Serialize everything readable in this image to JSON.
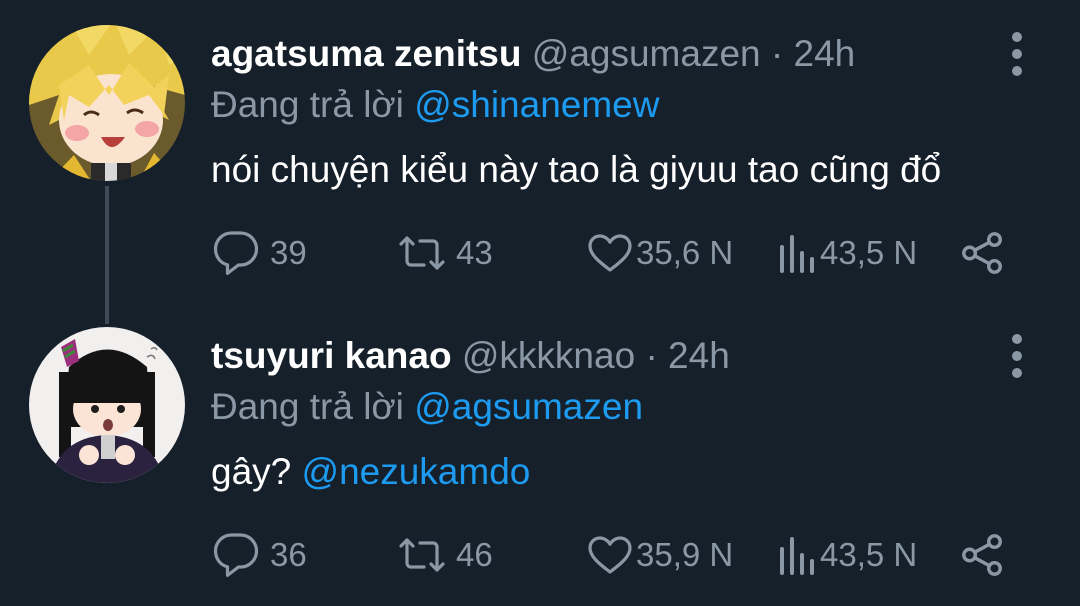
{
  "tweets": [
    {
      "display_name": "agatsuma zenitsu",
      "handle": "@agsumazen",
      "separator": "·",
      "time": "24h",
      "reply_prefix": "Đang trả lời",
      "reply_to": "@shinanemew",
      "body_text": "nói chuyện kiểu này tao là giyuu tao cũng đổ",
      "body_mention": "",
      "replies": "39",
      "retweets": "43",
      "likes": "35,6 N",
      "views": "43,5 N"
    },
    {
      "display_name": "tsuyuri kanao",
      "handle": "@kkkknao",
      "separator": "·",
      "time": "24h",
      "reply_prefix": "Đang trả lời",
      "reply_to": "@agsumazen",
      "body_text": "gây?",
      "body_mention": "@nezukamdo",
      "replies": "36",
      "retweets": "46",
      "likes": "35,9 N",
      "views": "43,5 N"
    }
  ],
  "icons": {
    "avatar_1": "avatar-zenitsu",
    "avatar_2": "avatar-kanao",
    "more": "more-vertical-icon",
    "reply": "reply-icon",
    "retweet": "retweet-icon",
    "like": "heart-icon",
    "views": "views-icon",
    "share": "share-icon"
  },
  "colors": {
    "background": "#16202b",
    "text": "#ffffff",
    "muted": "#8a98a5",
    "link": "#1d9bf0",
    "thread_line": "#3d4b58"
  }
}
